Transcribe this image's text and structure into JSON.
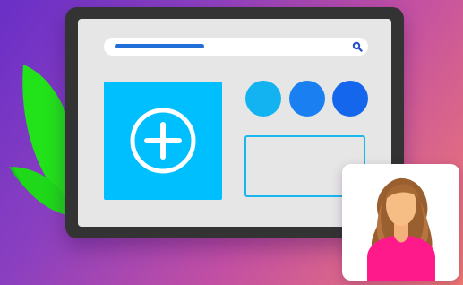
{
  "colors": {
    "accent_blue": "#00bfff",
    "progress_blue": "#1f6fd6",
    "leaf_green": "#22e21a",
    "avatar_pink": "#ff1a8c"
  },
  "search": {
    "progress": 0.37,
    "icon": "search-icon"
  },
  "add_tile": {
    "icon": "plus-circle-icon"
  },
  "swatches": [
    "#12b3f0",
    "#1a7ff0",
    "#1466ec"
  ],
  "avatar": {
    "icon": "user-avatar"
  }
}
